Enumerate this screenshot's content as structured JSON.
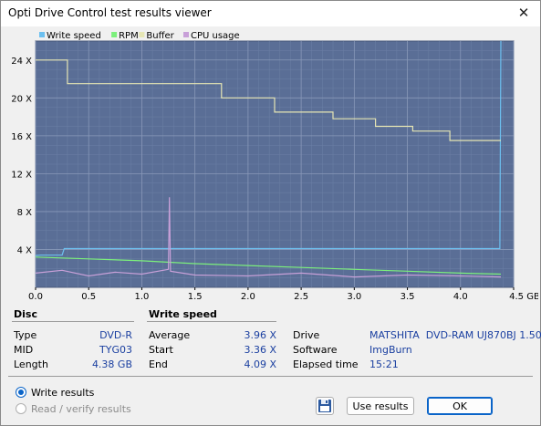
{
  "window": {
    "title": "Opti Drive Control test results viewer",
    "close_glyph": "✕"
  },
  "chart_data": {
    "type": "line",
    "legend": [
      {
        "name": "Write speed",
        "color": "#6cc0f0"
      },
      {
        "name": "RPM",
        "color": "#7cf07c"
      },
      {
        "name": "Buffer",
        "color": "#e6e6b4"
      },
      {
        "name": "CPU usage",
        "color": "#c8a0d8"
      }
    ],
    "xlim": [
      0,
      4.5
    ],
    "ylim": [
      0,
      26
    ],
    "x_ticks": [
      "0.0",
      "0.5",
      "1.0",
      "1.5",
      "2.0",
      "2.5",
      "3.0",
      "3.5",
      "4.0",
      "4.5 GB"
    ],
    "x_tick_values": [
      0,
      0.5,
      1.0,
      1.5,
      2.0,
      2.5,
      3.0,
      3.5,
      4.0,
      4.5
    ],
    "y_ticks": [
      "4 X",
      "8 X",
      "12 X",
      "16 X",
      "20 X",
      "24 X"
    ],
    "y_tick_values": [
      4,
      8,
      12,
      16,
      20,
      24
    ],
    "background": "#5a6e96",
    "grid": true,
    "series": [
      {
        "name": "Write speed",
        "x": [
          0.0,
          0.05,
          0.2,
          0.25,
          0.27,
          0.5,
          1.0,
          1.5,
          2.0,
          2.5,
          3.0,
          3.5,
          4.0,
          4.37,
          4.38
        ],
        "values": [
          3.36,
          3.4,
          3.4,
          3.4,
          4.09,
          4.09,
          4.09,
          4.09,
          4.09,
          4.09,
          4.09,
          4.09,
          4.09,
          4.09,
          26
        ]
      },
      {
        "name": "RPM",
        "x": [
          0.0,
          0.5,
          1.0,
          1.5,
          2.0,
          2.5,
          3.0,
          3.5,
          4.0,
          4.38
        ],
        "values": [
          3.2,
          3.0,
          2.8,
          2.5,
          2.3,
          2.1,
          1.9,
          1.7,
          1.5,
          1.4
        ]
      },
      {
        "name": "Buffer",
        "x": [
          0.0,
          0.3,
          0.3,
          1.75,
          1.75,
          2.25,
          2.25,
          2.8,
          2.8,
          3.2,
          3.2,
          3.55,
          3.55,
          3.9,
          3.9,
          4.38
        ],
        "values": [
          24,
          24,
          21.5,
          21.5,
          20,
          20,
          18.5,
          18.5,
          17.8,
          17.8,
          17,
          17,
          16.5,
          16.5,
          15.5,
          15.5
        ]
      },
      {
        "name": "CPU usage",
        "x": [
          0.0,
          0.25,
          0.5,
          0.75,
          1.0,
          1.25,
          1.26,
          1.27,
          1.5,
          2.0,
          2.5,
          3.0,
          3.5,
          4.0,
          4.38
        ],
        "values": [
          1.5,
          1.8,
          1.2,
          1.6,
          1.4,
          1.9,
          9.5,
          1.7,
          1.3,
          1.2,
          1.5,
          1.1,
          1.3,
          1.2,
          1.1
        ]
      }
    ]
  },
  "disc": {
    "title": "Disc",
    "rows": [
      {
        "label": "Type",
        "value": "DVD-R"
      },
      {
        "label": "MID",
        "value": "TYG03"
      },
      {
        "label": "Length",
        "value": "4.38 GB"
      }
    ]
  },
  "write_speed": {
    "title": "Write speed",
    "rows": [
      {
        "label": "Average",
        "value": "3.96 X"
      },
      {
        "label": "Start",
        "value": "3.36 X"
      },
      {
        "label": "End",
        "value": "4.09 X"
      }
    ]
  },
  "info": {
    "rows": [
      {
        "label": "Drive",
        "value": "MATSHITA  DVD-RAM UJ870BJ 1.50"
      },
      {
        "label": "Software",
        "value": "ImgBurn"
      },
      {
        "label": "Elapsed time",
        "value": "15:21"
      }
    ]
  },
  "options": {
    "write_results": "Write results",
    "read_verify": "Read / verify results",
    "selected": "write_results"
  },
  "buttons": {
    "use_results": "Use results",
    "ok": "OK",
    "save_icon": "floppy-disk"
  }
}
